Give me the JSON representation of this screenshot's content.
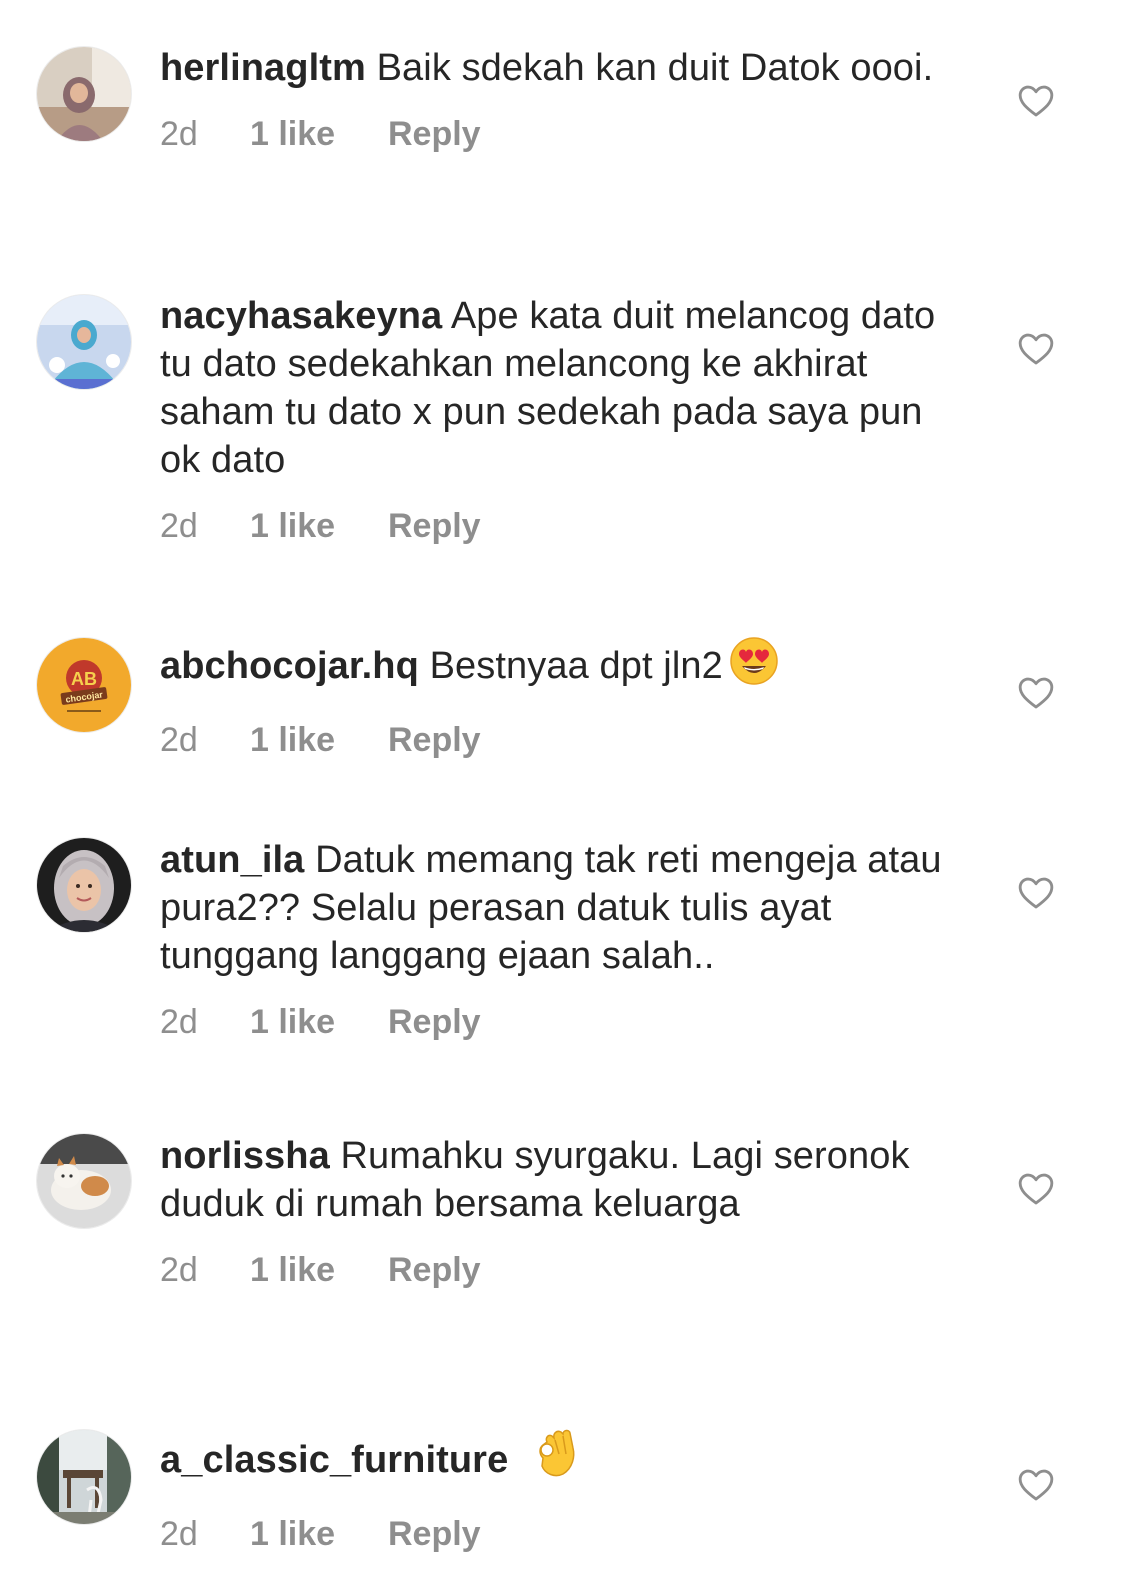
{
  "comments": [
    {
      "username": "herlinagltm",
      "text": "Baik sdekah kan duit Datok oooi.",
      "age": "2d",
      "likes": "1 like",
      "reply": "Reply"
    },
    {
      "username": "nacyhasakeyna",
      "text": "Ape kata duit melancog dato tu dato sedekahkan melancong ke akhirat saham tu dato x pun sedekah pada saya pun ok dato",
      "age": "2d",
      "likes": "1 like",
      "reply": "Reply"
    },
    {
      "username": "abchocojar.hq",
      "text": "Bestnyaa dpt jln2",
      "emoji": "heart-eyes-emoji",
      "age": "2d",
      "likes": "1 like",
      "reply": "Reply",
      "avatar_logo": "AB",
      "avatar_logo_sub": "chocojar"
    },
    {
      "username": "atun_ila",
      "text": "Datuk memang tak reti mengeja atau pura2??  Selalu perasan datuk tulis ayat tunggang langgang ejaan salah..",
      "age": "2d",
      "likes": "1 like",
      "reply": "Reply"
    },
    {
      "username": "norlissha",
      "text": "Rumahku syurgaku. Lagi seronok duduk di rumah bersama keluarga",
      "age": "2d",
      "likes": "1 like",
      "reply": "Reply"
    },
    {
      "username": "a_classic_furniture",
      "text": "",
      "emoji": "ok-hand-emoji",
      "age": "2d",
      "likes": "1 like",
      "reply": "Reply"
    }
  ],
  "colors": {
    "text": "#262626",
    "secondary": "#8e8e8e",
    "heart_outline": "#8e8e8e",
    "background": "#ffffff"
  },
  "icons": {
    "like": "heart-outline-icon"
  }
}
